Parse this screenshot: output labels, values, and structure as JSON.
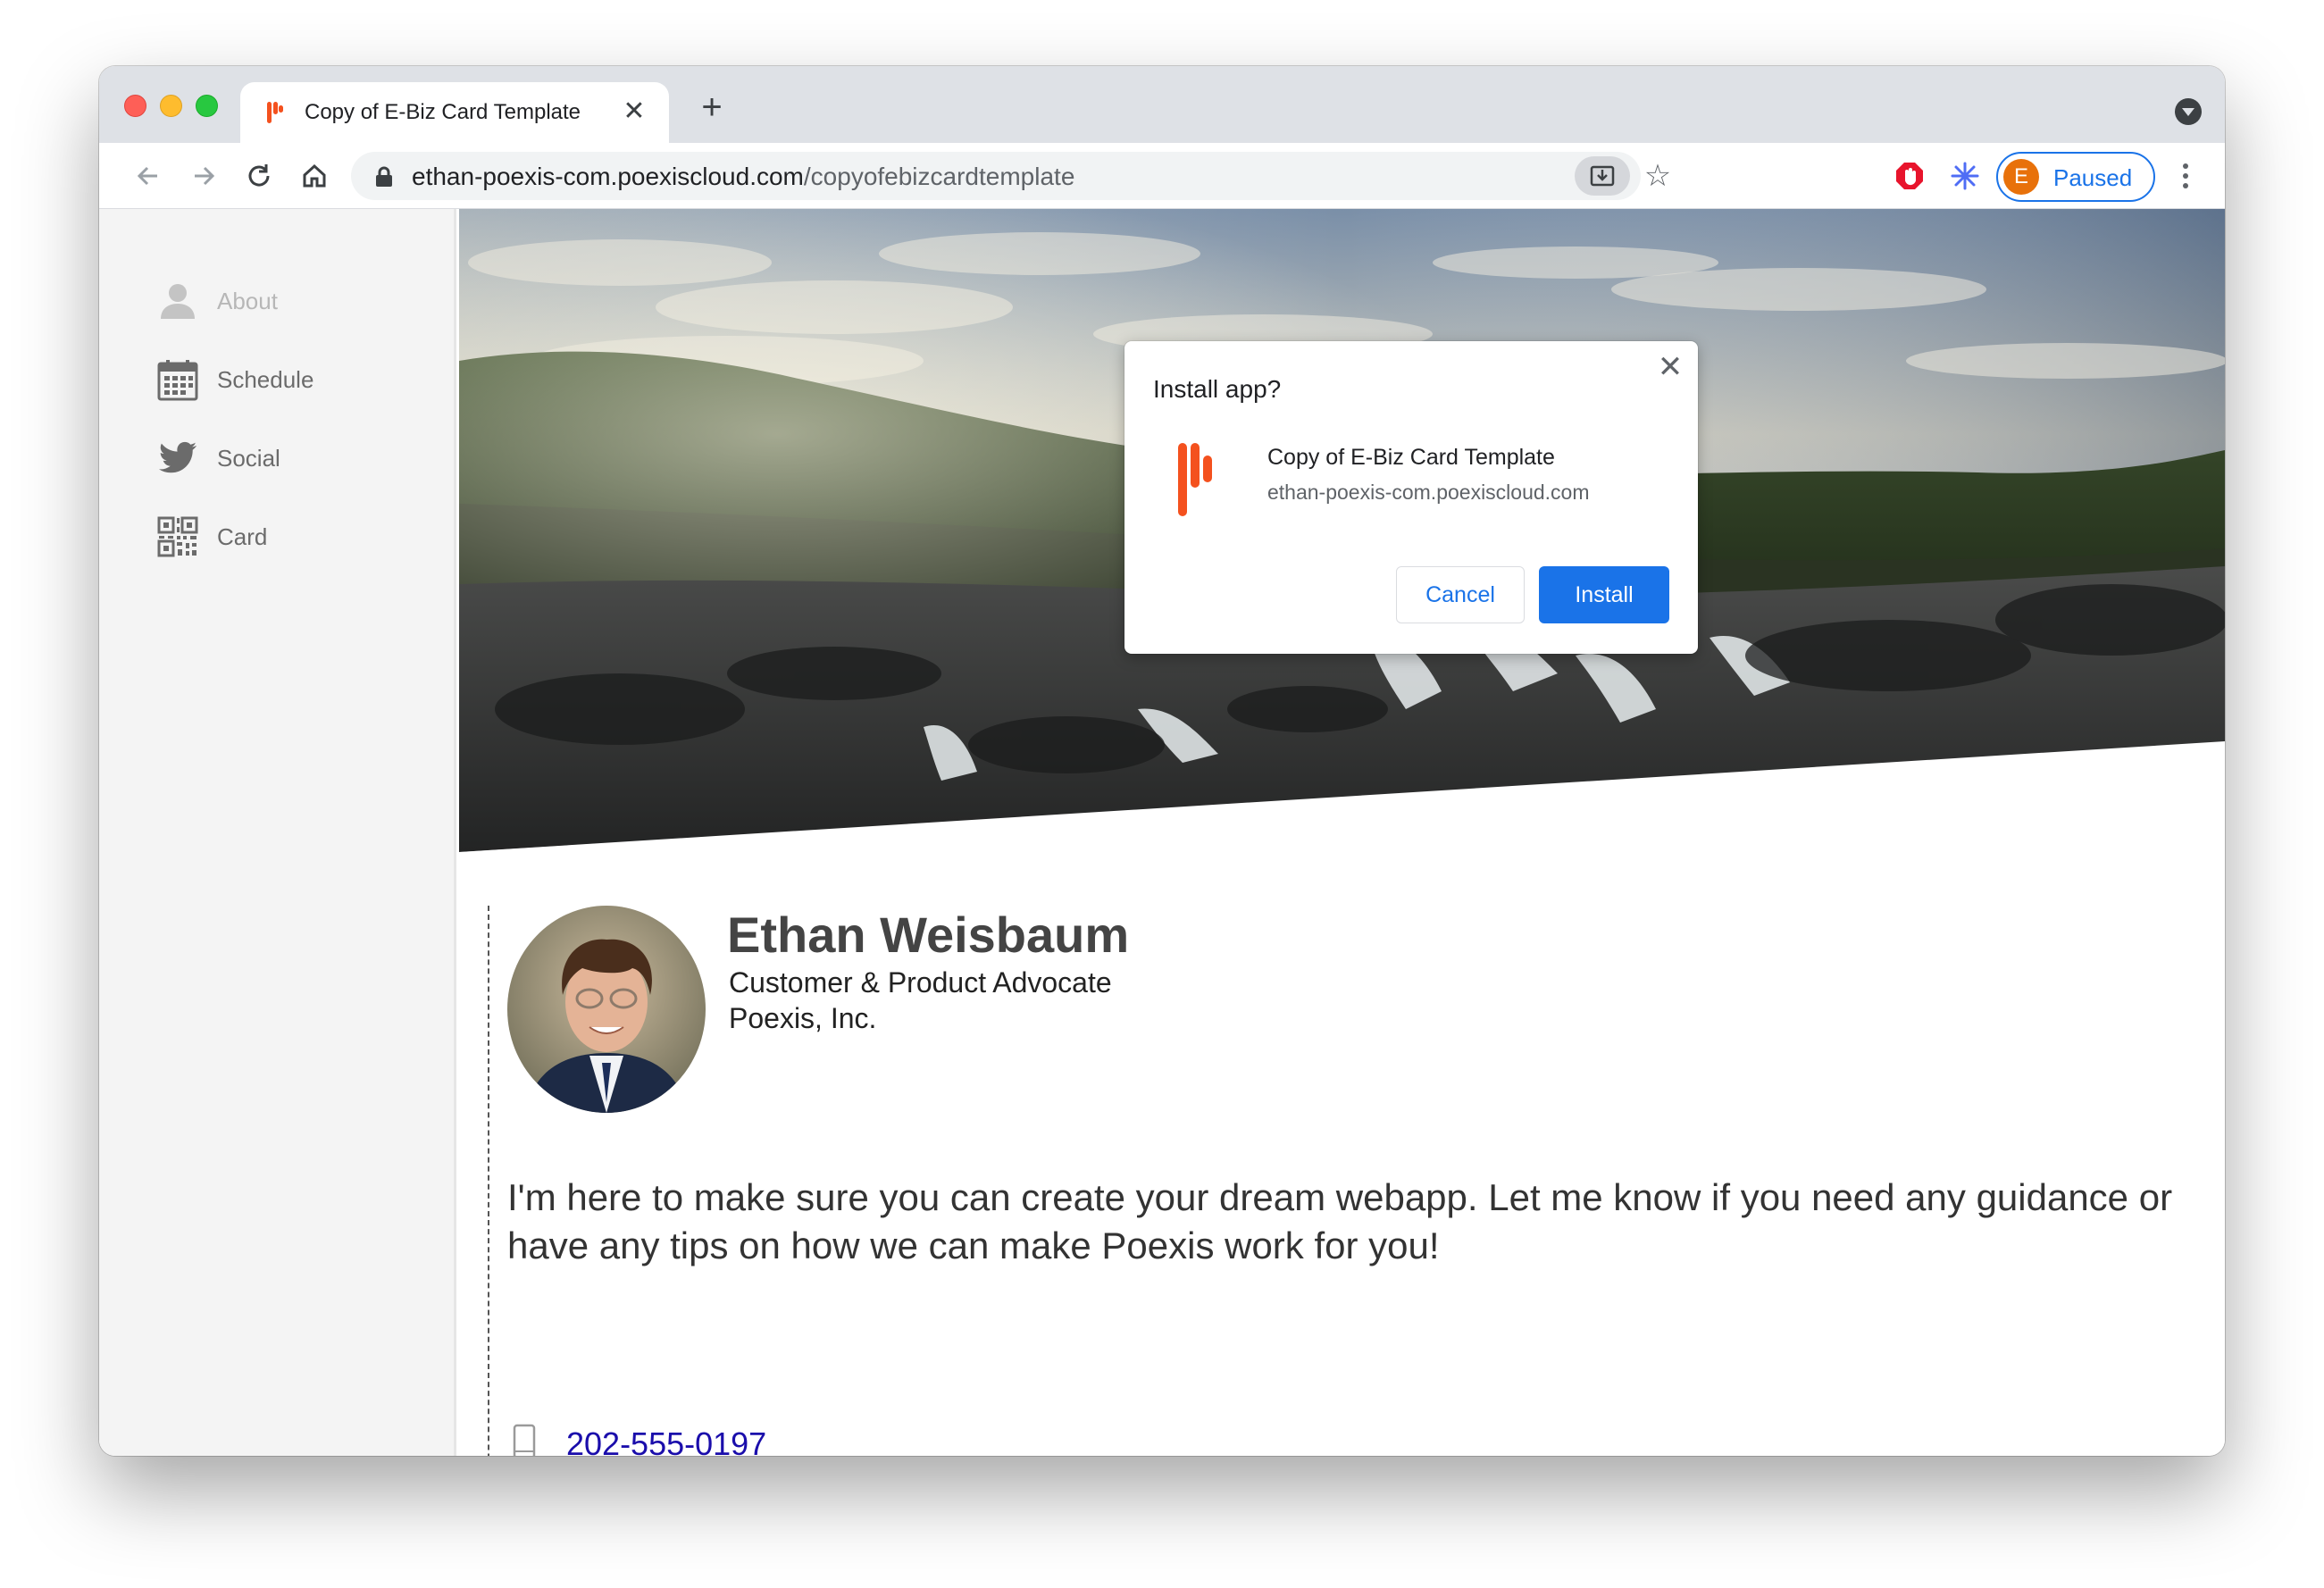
{
  "browser": {
    "tab": {
      "title": "Copy of E-Biz Card Template",
      "close_glyph": "✕"
    },
    "new_tab_glyph": "+",
    "url": {
      "host": "ethan-poexis-com.poexiscloud.com",
      "path": "/copyofebizcardtemplate"
    },
    "profile": {
      "initial": "E",
      "status": "Paused"
    },
    "toolbar_icons": [
      "back-arrow-icon",
      "forward-arrow-icon",
      "reload-icon",
      "home-icon",
      "lock-icon",
      "install-app-icon",
      "bookmark-star-icon",
      "adblock-icon",
      "snowflake-extension-icon",
      "printer-extension-icon",
      "extensions-puzzle-icon",
      "cast-icon",
      "kebab-menu-icon"
    ]
  },
  "install_dialog": {
    "title": "Install app?",
    "app_name": "Copy of E-Biz Card Template",
    "app_url": "ethan-poexis-com.poexiscloud.com",
    "cancel_label": "Cancel",
    "install_label": "Install",
    "close_glyph": "✕"
  },
  "sidebar": {
    "items": [
      {
        "label": "About",
        "icon": "person-icon",
        "dimmed": true
      },
      {
        "label": "Schedule",
        "icon": "calendar-icon"
      },
      {
        "label": "Social",
        "icon": "twitter-bird-icon"
      },
      {
        "label": "Card",
        "icon": "qr-code-icon"
      }
    ]
  },
  "profile": {
    "name": "Ethan Weisbaum",
    "title": "Customer & Product Advocate",
    "company": "Poexis, Inc.",
    "bio": "I'm here to make sure you can create your dream webapp. Let me know if you need any guidance or have any tips on how we can make Poexis work for you!",
    "phone": "202-555-0197"
  },
  "colors": {
    "accent_blue": "#1a73e8",
    "brand_red": "#f4511e",
    "tabstrip_bg": "#dee1e6",
    "sidebar_bg": "#f4f4f4"
  }
}
